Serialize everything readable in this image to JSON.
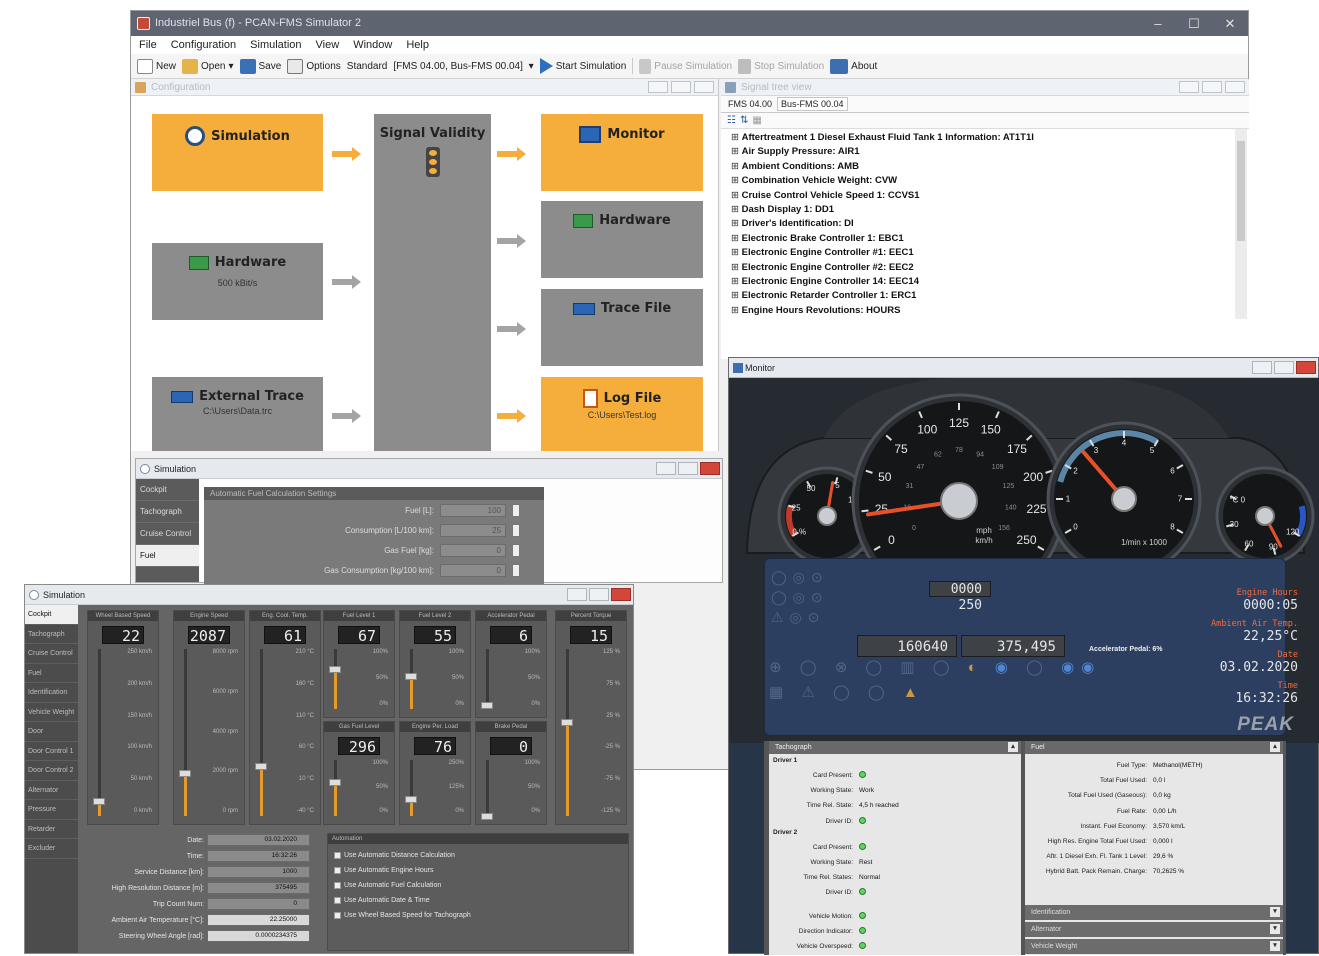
{
  "main_window": {
    "title": "Industriel Bus (f) - PCAN-FMS Simulator 2",
    "menu": [
      "File",
      "Configuration",
      "Simulation",
      "View",
      "Window",
      "Help"
    ],
    "toolbar": {
      "new": "New",
      "open": "Open",
      "save": "Save",
      "options": "Options",
      "standard_label": "Standard",
      "standard_value": "[FMS 04.00, Bus-FMS 00.04]",
      "start": "Start Simulation",
      "pause": "Pause Simulation",
      "stop": "Stop Simulation",
      "about": "About"
    }
  },
  "config_panel": {
    "title": "Configuration",
    "blocks": {
      "simulation": "Simulation",
      "signal_validity": "Signal Validity",
      "monitor": "Monitor",
      "hardware_in": "Hardware",
      "hardware_in_sub": "500 kBit/s",
      "hardware_out": "Hardware",
      "trace_file": "Trace File",
      "external_trace": "External Trace",
      "external_trace_sub": "C:\\Users\\Data.trc",
      "log_file": "Log File",
      "log_file_sub": "C:\\Users\\Test.log"
    }
  },
  "tree_panel": {
    "title": "Signal tree view",
    "tabs": [
      "FMS 04.00",
      "Bus-FMS 00.04"
    ],
    "items": [
      "Aftertreatment 1 Diesel Exhaust Fluid Tank 1 Information: AT1T1I",
      "Air Supply Pressure: AIR1",
      "Ambient Conditions: AMB",
      "Combination Vehicle Weight: CVW",
      "Cruise Control Vehicle Speed 1: CCVS1",
      "Dash Display 1: DD1",
      "Driver's Identification: DI",
      "Electronic Brake Controller 1: EBC1",
      "Electronic Engine Controller #1: EEC1",
      "Electronic Engine Controller #2: EEC2",
      "Electronic Engine Controller 14: EEC14",
      "Electronic Retarder Controller 1: ERC1",
      "Engine Hours Revolutions: HOURS"
    ]
  },
  "sim_mid": {
    "title": "Simulation",
    "nav": [
      "Cockpit",
      "Tachograph",
      "Cruise Control",
      "Fuel"
    ],
    "section": "Automatic Fuel Calculation Settings",
    "fields": [
      {
        "label": "Fuel [L]:",
        "value": "100"
      },
      {
        "label": "Consumption [L/100 km]:",
        "value": "25"
      },
      {
        "label": "Gas Fuel [kg]:",
        "value": "0"
      },
      {
        "label": "Gas Consumption [kg/100 km]:",
        "value": "0"
      }
    ]
  },
  "sim_front": {
    "title": "Simulation",
    "nav": [
      "Cockpit",
      "Tachograph",
      "Cruise Control",
      "Fuel",
      "Identification",
      "Vehicle Weight",
      "Door",
      "Door Control 1",
      "Door Control 2",
      "Alternator",
      "Pressure",
      "Retarder",
      "Excluder"
    ],
    "gauges_top": [
      {
        "title": "Wheel Based Speed",
        "value": "22",
        "ticks": [
          "250 km/h",
          "200 km/h",
          "150 km/h",
          "100 km/h",
          "50 km/h",
          "0 km/h"
        ]
      },
      {
        "title": "Engine Speed",
        "value": "2087",
        "ticks": [
          "8000 rpm",
          "6000 rpm",
          "4000 rpm",
          "2000 rpm",
          "0 rpm"
        ]
      },
      {
        "title": "Eng. Cool. Temp.",
        "value": "61",
        "ticks": [
          "210 °C",
          "160 °C",
          "110 °C",
          "60 °C",
          "10 °C",
          "-40 °C"
        ]
      },
      {
        "title": "Fuel Level 1",
        "value": "67",
        "ticks": [
          "100%",
          "50%",
          "0%"
        ]
      },
      {
        "title": "Fuel Level 2",
        "value": "55",
        "ticks": [
          "100%",
          "50%",
          "0%"
        ]
      },
      {
        "title": "Accelerator Pedal",
        "value": "6",
        "ticks": [
          "100%",
          "50%",
          "0%"
        ]
      },
      {
        "title": "Percent Torque",
        "value": "15",
        "ticks": [
          "125 %",
          "75 %",
          "25 %",
          "-25 %",
          "-75 %",
          "-125 %"
        ]
      }
    ],
    "gauges_bottom": [
      {
        "title": "Gas Fuel Level",
        "value": "296",
        "ticks": [
          "100%",
          "50%",
          "0%"
        ]
      },
      {
        "title": "Engine Per. Load",
        "value": "76",
        "ticks": [
          "250%",
          "125%",
          "0%"
        ]
      },
      {
        "title": "Brake Pedal",
        "value": "0",
        "ticks": [
          "100%",
          "50%",
          "0%"
        ]
      }
    ],
    "fields": [
      {
        "label": "Date:",
        "value": "03.02.2020"
      },
      {
        "label": "Time:",
        "value": "16:32:26"
      },
      {
        "label": "Service Distance [km]:",
        "value": "1000"
      },
      {
        "label": "High Resolution Distance [m]:",
        "value": "375495"
      },
      {
        "label": "Trip Count Num:",
        "value": "0"
      },
      {
        "label": "Ambient Air Temperature [°C]:",
        "value": "22.25000"
      },
      {
        "label": "Steering Wheel Angle [rad]:",
        "value": "0.0000234375"
      }
    ],
    "automation_title": "Automation",
    "automation": [
      "Use Automatic Distance Calculation",
      "Use Automatic Engine Hours",
      "Use Automatic Fuel Calculation",
      "Use Automatic Date & Time",
      "Use Wheel Based Speed for Tachograph"
    ]
  },
  "monitor": {
    "title": "Monitor",
    "speedo_ticks": [
      "0",
      "25",
      "50",
      "75",
      "100",
      "125",
      "150",
      "175",
      "200",
      "225",
      "250"
    ],
    "speedo_inner": [
      "0",
      "16",
      "31",
      "47",
      "62",
      "78",
      "94",
      "109",
      "125",
      "140",
      "156"
    ],
    "speedo_units": [
      "mph",
      "km/h"
    ],
    "tacho_ticks": [
      "0",
      "1",
      "2",
      "3",
      "4",
      "5",
      "6",
      "7",
      "8"
    ],
    "tacho_unit": "1/min x 1000",
    "left_gauge_ticks": [
      "0 %",
      "25",
      "50",
      "75",
      "100"
    ],
    "right_gauge_ticks": [
      "°C 0",
      "30",
      "60",
      "90",
      "120"
    ],
    "trip_value": "0000 250",
    "odometer": "160640",
    "distance": "375,495",
    "accel_label": "Accelerator Pedal: 6%",
    "readouts": [
      {
        "label": "Engine Hours",
        "value": "0000:05"
      },
      {
        "label": "Ambient Air Temp.",
        "value": "22,25°C"
      },
      {
        "label": "Date",
        "value": "03.02.2020"
      },
      {
        "label": "Time",
        "value": "16:32:26"
      }
    ],
    "brand": "PEAK",
    "tachograph": {
      "title": "Tachograph",
      "driver1": "Driver 1",
      "driver2": "Driver 2",
      "d1": [
        {
          "k": "Card Present:",
          "v": ""
        },
        {
          "k": "Working State:",
          "v": "Work"
        },
        {
          "k": "Time Rel. State:",
          "v": "4,5 h reached"
        },
        {
          "k": "Driver ID:",
          "v": ""
        }
      ],
      "d2": [
        {
          "k": "Card Present:",
          "v": ""
        },
        {
          "k": "Working State:",
          "v": "Rest"
        },
        {
          "k": "Time Rel. States:",
          "v": "Normal"
        },
        {
          "k": "Driver ID:",
          "v": ""
        }
      ],
      "vehicle": [
        {
          "k": "Vehicle Motion:",
          "v": ""
        },
        {
          "k": "Direction Indicator:",
          "v": ""
        },
        {
          "k": "Vehicle Overspeed:",
          "v": ""
        }
      ]
    },
    "fuel": {
      "title": "Fuel",
      "rows": [
        {
          "k": "Fuel Type:",
          "v": "Methanol(METH)"
        },
        {
          "k": "Total Fuel Used:",
          "v": "0,0 l"
        },
        {
          "k": "Total Fuel Used (Gaseous):",
          "v": "0,0 kg"
        },
        {
          "k": "Fuel Rate:",
          "v": "0,00 L/h"
        },
        {
          "k": "Instant. Fuel Economy:",
          "v": "3,570 km/L"
        },
        {
          "k": "High Res. Engine Total Fuel Used:",
          "v": "0,000 l"
        },
        {
          "k": "Aftr. 1 Diesel Exh. Fl. Tank 1 Level:",
          "v": "29,6 %"
        },
        {
          "k": "Hybrid Batt. Pack Remain. Charge:",
          "v": "70,2625 %"
        }
      ],
      "footer": [
        "Identification",
        "Alternator",
        "Vehicle Weight"
      ]
    }
  }
}
